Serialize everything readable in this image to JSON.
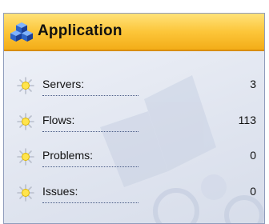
{
  "panel": {
    "title": "Application",
    "icon": "cubes-icon"
  },
  "stats": [
    {
      "label": "Servers:",
      "value": "3",
      "icon": "star-burst-icon"
    },
    {
      "label": "Flows:",
      "value": "113",
      "icon": "star-burst-icon"
    },
    {
      "label": "Problems:",
      "value": "0",
      "icon": "star-burst-icon"
    },
    {
      "label": "Issues:",
      "value": "0",
      "icon": "star-burst-icon"
    }
  ],
  "colors": {
    "header_gradient_top": "#ffe27a",
    "header_gradient_bottom": "#f3ad18",
    "panel_background": "#e6eaf3",
    "border": "#8f9cbc"
  }
}
